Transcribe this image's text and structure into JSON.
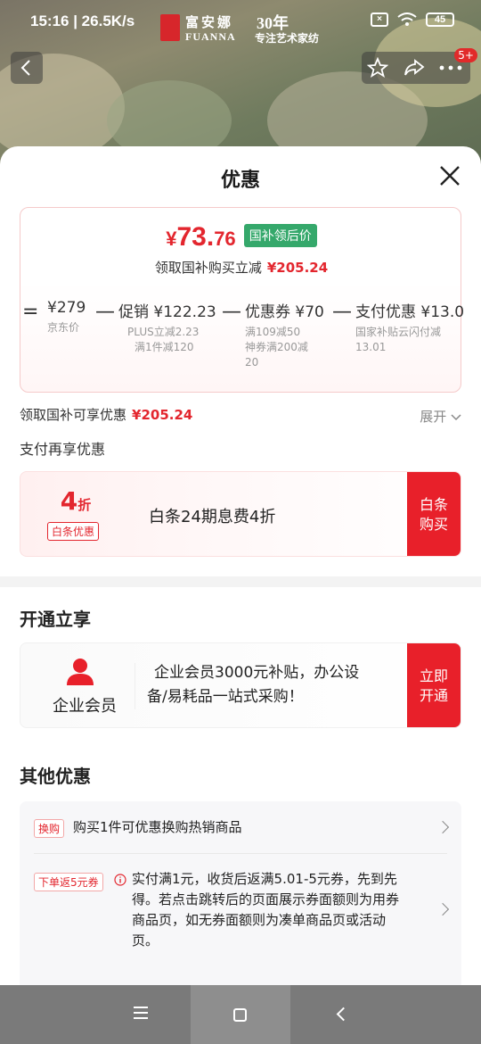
{
  "status_bar": {
    "time": "15:16 | 26.5K/s",
    "battery": "45"
  },
  "brand": {
    "name_cn": "富安娜",
    "name_en": "FUANNA",
    "years": "30年",
    "slogan": "专注艺术家纺"
  },
  "notification_badge": "5+",
  "sheet": {
    "title": "优惠",
    "price_card": {
      "currency": "¥",
      "price_int": "73.",
      "price_dec": "76",
      "price_tag": "国补领后价",
      "subsidy_text": "领取国补购买立减",
      "subsidy_amount": "¥205.24",
      "calc": [
        {
          "op": "=",
          "value": "¥279",
          "notes": [
            "京东价"
          ]
        },
        {
          "op": "—",
          "value": "促销 ¥122.23",
          "notes": [
            "PLUS立减2.23",
            "满1件减120"
          ]
        },
        {
          "op": "—",
          "value": "优惠券 ¥70",
          "notes": [
            "满109减50",
            "神券满200减",
            "20"
          ]
        },
        {
          "op": "—",
          "value": "支付优惠 ¥13.0",
          "notes": [
            "国家补贴云闪付减",
            "13.01"
          ]
        }
      ]
    },
    "summary_text": "领取国补可享优惠",
    "summary_amount": "¥205.24",
    "expand_label": "展开",
    "pay_title": "支付再享优惠",
    "baitiao": {
      "discount": "4",
      "discount_unit": "折",
      "badge": "白条优惠",
      "text": "白条24期息费4折",
      "button_line1": "白条",
      "button_line2": "购买"
    },
    "open_title": "开通立享",
    "vip": {
      "label": "企业会员",
      "text_line1": "企业会员3000元补贴，办公设",
      "text_line2": "备/易耗品一站式采购！",
      "button_line1": "立即",
      "button_line2": "开通"
    },
    "other_title": "其他优惠",
    "other_items": [
      {
        "tag": "换购",
        "lines": [
          "购买1件可优惠换购热销商品"
        ]
      },
      {
        "tag": "下单返5元券",
        "lines": [
          "实付满1元，收货后返满5.01-5元券，先到先",
          "得。若点击跳转后的页面展示券面额则为用券",
          "商品页，如无券面额则为凑单商品页或活动",
          "页。"
        ]
      }
    ]
  }
}
